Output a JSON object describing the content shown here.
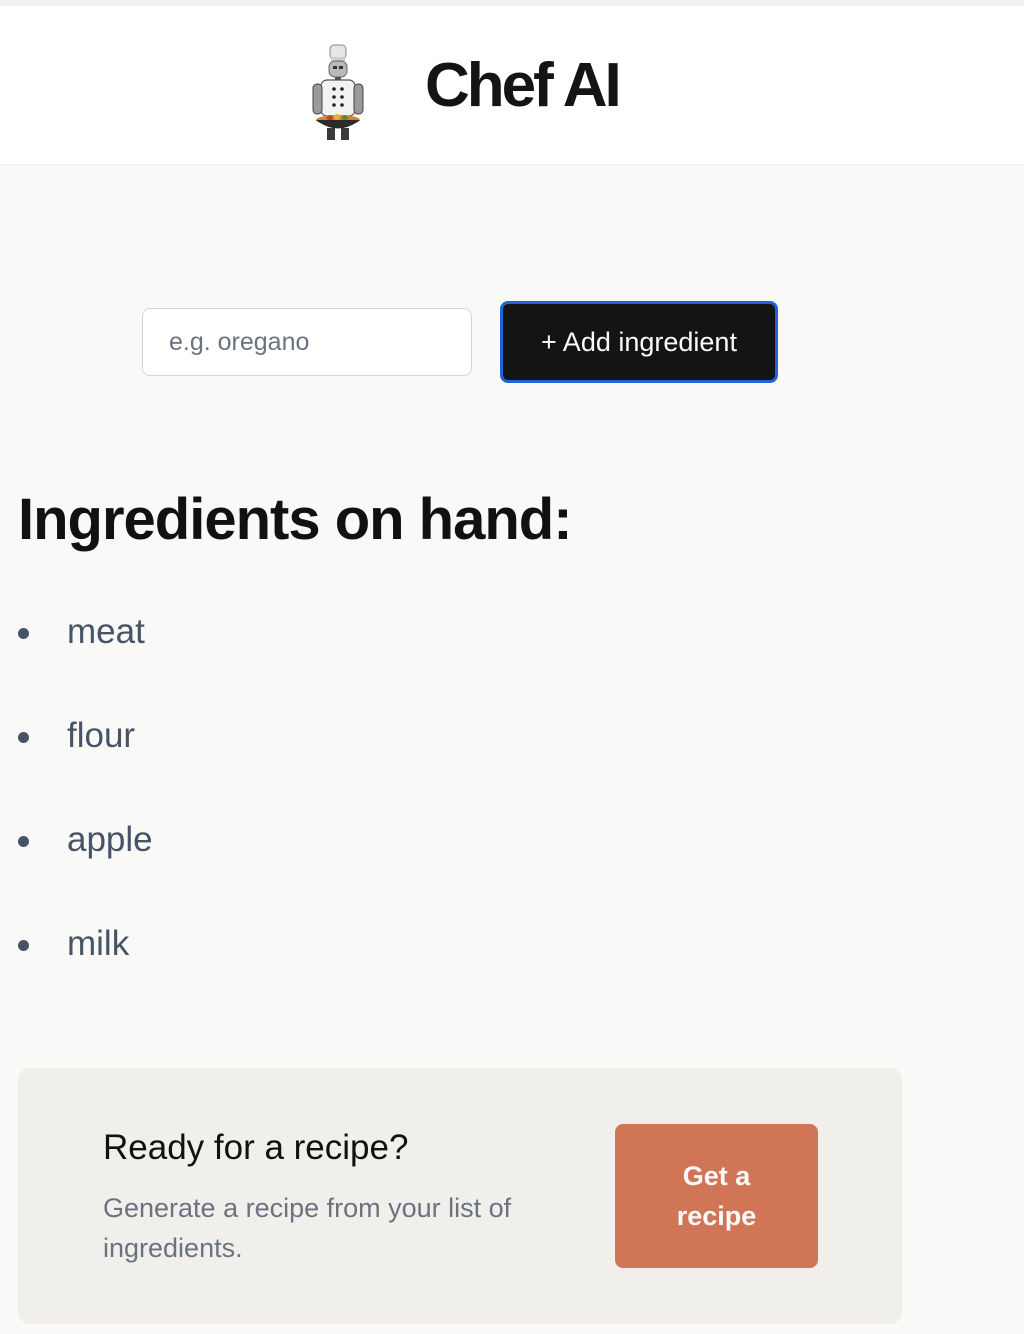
{
  "header": {
    "brand": "Chef AI",
    "logo_icon": "robot-chef-icon"
  },
  "form": {
    "input_placeholder": "e.g. oregano",
    "input_value": "",
    "add_button_label": "+ Add ingredient"
  },
  "ingredients": {
    "heading": "Ingredients on hand:",
    "items": [
      "meat",
      "flour",
      "apple",
      "milk"
    ]
  },
  "recipe_card": {
    "title": "Ready for a recipe?",
    "description": "Generate a recipe from your list of ingredients.",
    "button_label": "Get a recipe"
  },
  "colors": {
    "background": "#f9f9f7",
    "button_dark": "#141413",
    "focus_ring": "#1f64d8",
    "accent": "#d17557",
    "card": "#f0efeb",
    "list_text": "#475467"
  }
}
